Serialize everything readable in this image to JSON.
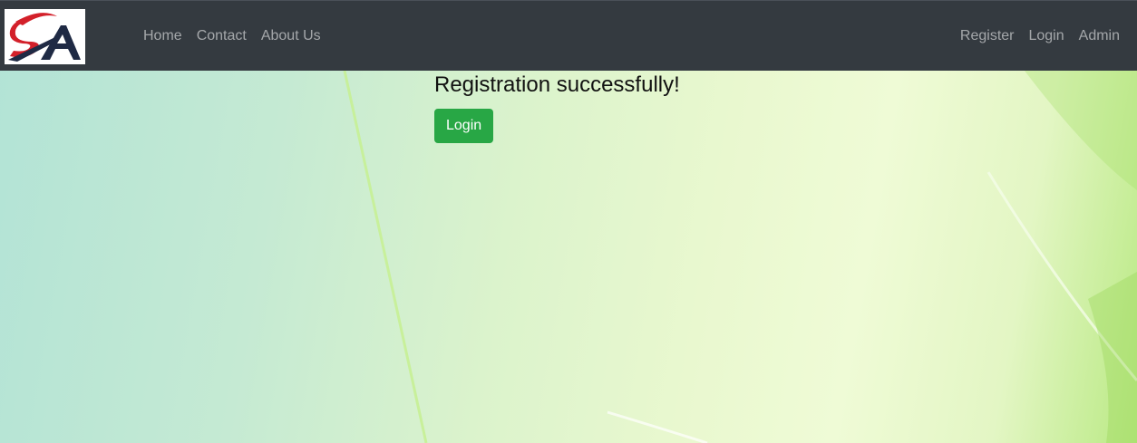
{
  "nav": {
    "brand_logo_text": "SA",
    "links_left": [
      "Home",
      "Contact",
      "About Us"
    ],
    "links_right": [
      "Register",
      "Login",
      "Admin"
    ]
  },
  "main": {
    "heading": "Registration successfully!",
    "login_button": "Login"
  },
  "colors": {
    "navbar_bg": "#343a40",
    "nav_link": "rgba(255,255,255,0.55)",
    "button_green": "#28a745",
    "logo_red": "#d3202a",
    "logo_navy": "#1f2a44"
  }
}
